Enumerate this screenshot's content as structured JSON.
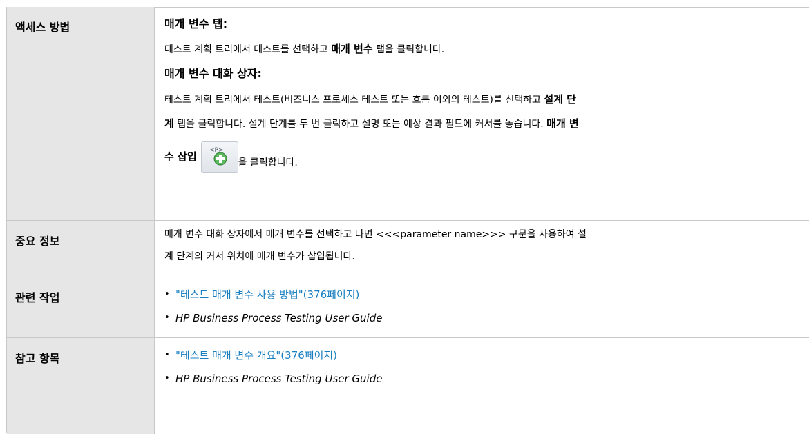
{
  "rows": {
    "access": {
      "label": "액세스 방법",
      "tab_heading": "매개 변수 탭:",
      "tab_text_1": "테스트 계획 트리에서 테스트를 선택하고 ",
      "tab_bold": "매개 변수",
      "tab_text_2": " 탭을 클릭합니다.",
      "dialog_heading": "매개 변수 대화 상자:",
      "dialog_text_1": "테스트 계획 트리에서 테스트(비즈니스 프로세스 테스트 또는 흐름 이외의 테스트)를 선택하고 ",
      "dialog_bold_1a": "설계 단",
      "dialog_bold_1b": "계",
      "dialog_text_2": " 탭을 클릭합니다. 설계 단계를 두 번 클릭하고 설명 또는 예상 결과 필드에 커서를 놓습니다. ",
      "dialog_bold_2a": "매개 변",
      "dialog_bold_2b": "수 삽입",
      "dialog_text_3": "을 클릭합니다.",
      "icon": "insert-parameter-icon"
    },
    "important": {
      "label": "중요 정보",
      "line1": "매개 변수 대화 상자에서 매개 변수를 선택하고 나면 <<<parameter name>>> 구문을 사용하여 설",
      "line2": "계 단계의 커서 위치에 매개 변수가 삽입됩니다."
    },
    "tasks": {
      "label": "관련 작업",
      "link": "\"테스트 매개 변수 사용 방법\"(376페이지)",
      "guide": "HP Business Process Testing User Guide"
    },
    "see_also": {
      "label": "참고 항목",
      "link": "\"테스트 매개 변수 개요\"(376페이지)",
      "guide": "HP Business Process Testing User Guide"
    }
  },
  "colors": {
    "label_bg": "#e6e6e6",
    "link": "#1a7fc0",
    "border": "#c8c8c8"
  }
}
